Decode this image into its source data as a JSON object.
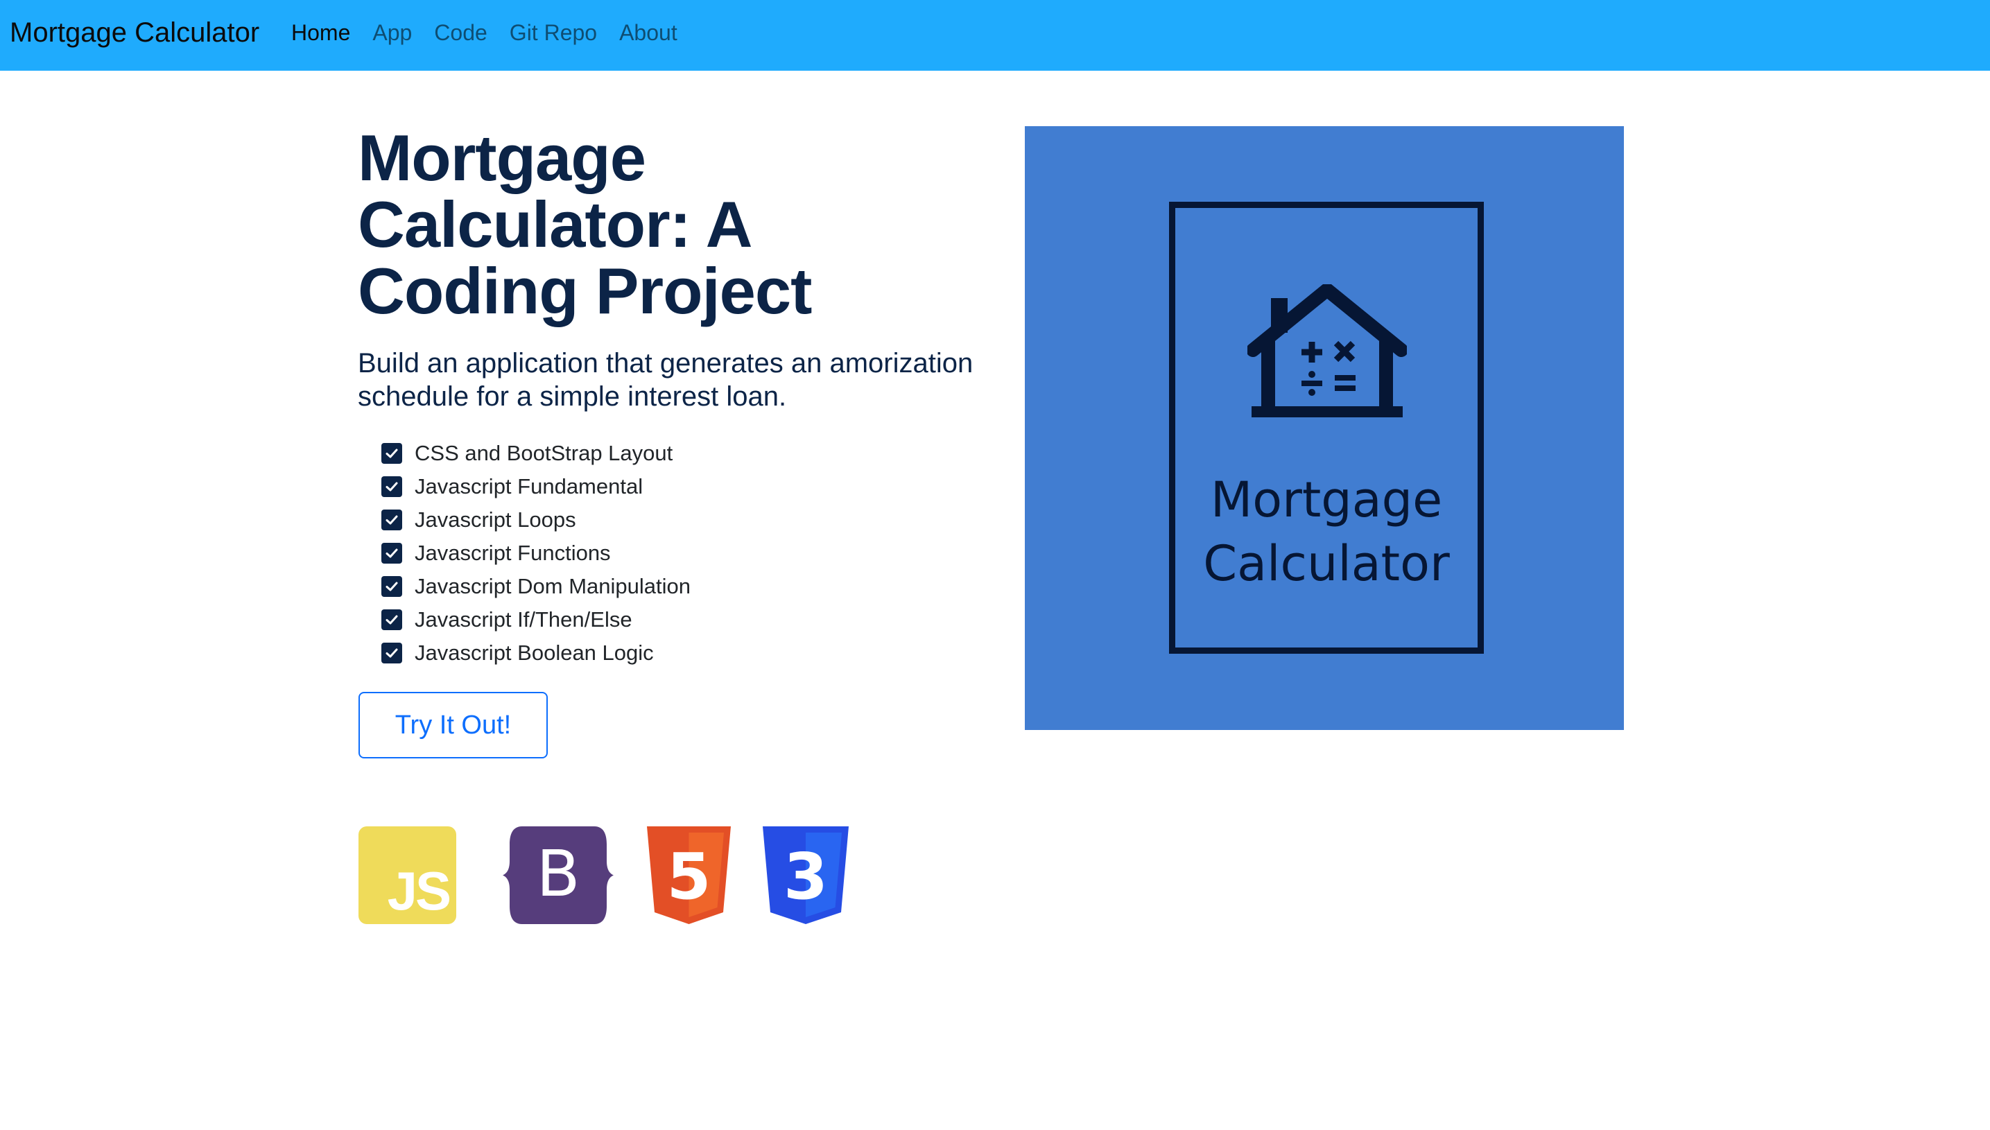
{
  "navbar": {
    "brand": "Mortgage Calculator",
    "links": [
      {
        "label": "Home",
        "active": true
      },
      {
        "label": "App",
        "active": false
      },
      {
        "label": "Code",
        "active": false
      },
      {
        "label": "Git Repo",
        "active": false
      },
      {
        "label": "About",
        "active": false
      }
    ],
    "background": "#1fabfd"
  },
  "hero": {
    "title": "Mortgage Calculator: A Coding Project",
    "subtitle": "Build an application that generates an amorization schedule for a simple interest loan.",
    "features": [
      "CSS and BootStrap Layout",
      "Javascript Fundamental",
      "Javascript Loops",
      "Javascript Functions",
      "Javascript Dom Manipulation",
      "Javascript If/Then/Else",
      "Javascript Boolean Logic"
    ],
    "button_label": "Try It Out!"
  },
  "tech_logos": [
    {
      "icon": "javascript-logo-icon",
      "text": "JS",
      "color": "#efdb5a"
    },
    {
      "icon": "bootstrap-logo-icon",
      "text": "B",
      "color": "#563d7c"
    },
    {
      "icon": "html5-logo-icon",
      "text": "5",
      "color": "#e34f26"
    },
    {
      "icon": "css3-logo-icon",
      "text": "3",
      "color": "#264de4"
    }
  ],
  "hero_image": {
    "caption_line1": "Mortgage",
    "caption_line2": "Calculator",
    "background": "#417dd1",
    "icon": "house-calculator-icon"
  },
  "colors": {
    "heading": "#0c2447",
    "button_accent": "#0d6efd"
  }
}
